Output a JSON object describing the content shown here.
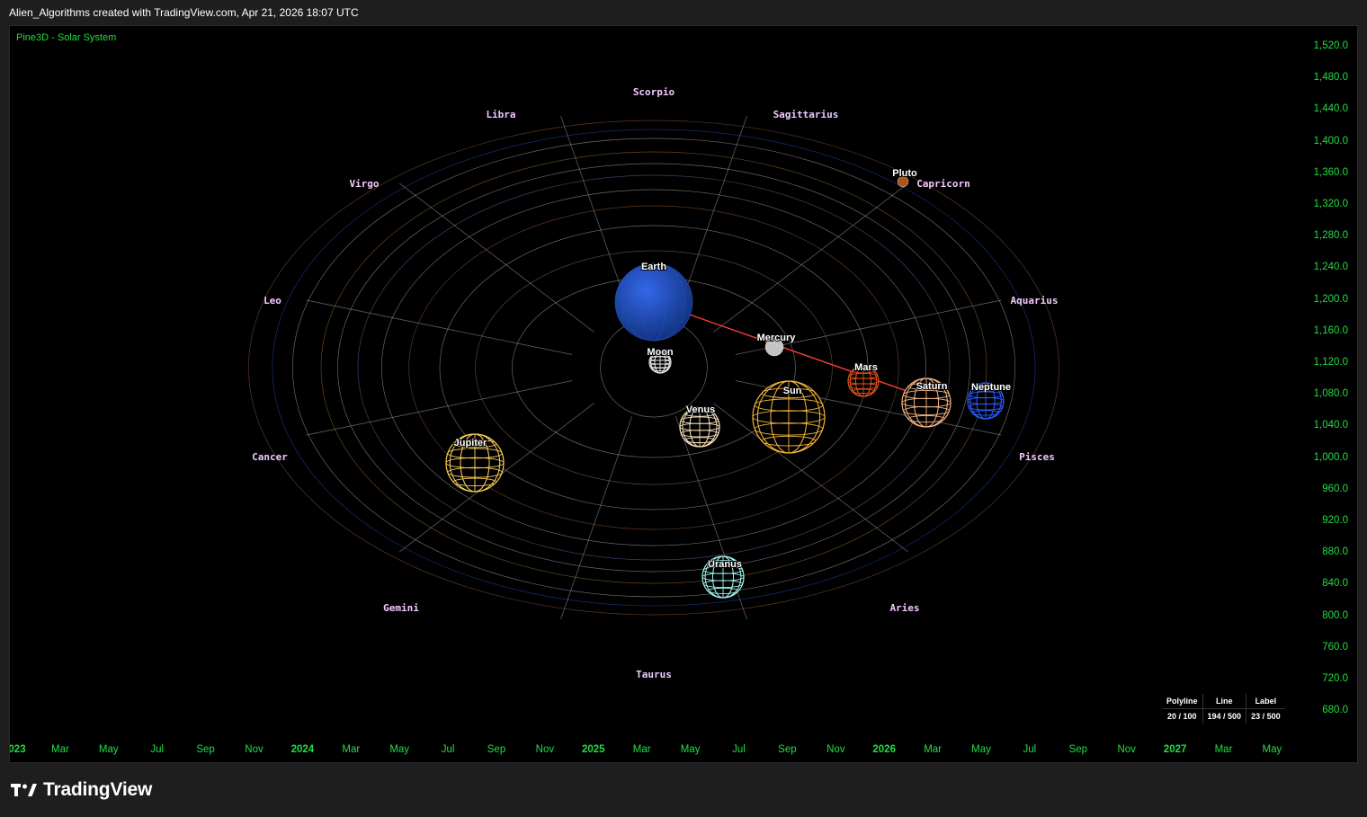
{
  "header": {
    "caption": "Alien_Algorithms created with TradingView.com, Apr 21, 2026 18:07 UTC"
  },
  "indicator": {
    "title": "Pine3D - Solar System"
  },
  "price_axis": {
    "ticks": [
      "1,520.0",
      "1,480.0",
      "1,440.0",
      "1,400.0",
      "1,360.0",
      "1,320.0",
      "1,280.0",
      "1,240.0",
      "1,200.0",
      "1,160.0",
      "1,120.0",
      "1,080.0",
      "1,040.0",
      "1,000.0",
      "960.0",
      "920.0",
      "880.0",
      "840.0",
      "800.0",
      "760.0",
      "720.0",
      "680.0"
    ]
  },
  "time_axis": {
    "ticks": [
      {
        "label": "023",
        "year": true
      },
      {
        "label": "Mar"
      },
      {
        "label": "May"
      },
      {
        "label": "Jul"
      },
      {
        "label": "Sep"
      },
      {
        "label": "Nov"
      },
      {
        "label": "2024",
        "year": true
      },
      {
        "label": "Mar"
      },
      {
        "label": "May"
      },
      {
        "label": "Jul"
      },
      {
        "label": "Sep"
      },
      {
        "label": "Nov"
      },
      {
        "label": "2025",
        "year": true
      },
      {
        "label": "Mar"
      },
      {
        "label": "May"
      },
      {
        "label": "Jul"
      },
      {
        "label": "Sep"
      },
      {
        "label": "Nov"
      },
      {
        "label": "2026",
        "year": true
      },
      {
        "label": "Mar"
      },
      {
        "label": "May"
      },
      {
        "label": "Jul"
      },
      {
        "label": "Sep"
      },
      {
        "label": "Nov"
      },
      {
        "label": "2027",
        "year": true
      },
      {
        "label": "Mar"
      },
      {
        "label": "May"
      }
    ]
  },
  "zodiac": [
    "Scorpio",
    "Libra",
    "Sagittarius",
    "Virgo",
    "Capricorn",
    "Leo",
    "Aquarius",
    "Cancer",
    "Pisces",
    "Gemini",
    "Aries",
    "Taurus"
  ],
  "planets": [
    {
      "name": "Earth",
      "color": "#1f4fc4",
      "type": "solid"
    },
    {
      "name": "Moon",
      "color": "#e8e8e8",
      "type": "wire"
    },
    {
      "name": "Mercury",
      "color": "#cfcfcf",
      "type": "solid"
    },
    {
      "name": "Mars",
      "color": "#e0501c",
      "type": "wire"
    },
    {
      "name": "Pluto",
      "color": "#b85a1c",
      "type": "solid"
    },
    {
      "name": "Saturn",
      "color": "#f0b080",
      "type": "wire"
    },
    {
      "name": "Neptune",
      "color": "#2a5cff",
      "type": "wire"
    },
    {
      "name": "Venus",
      "color": "#f5dcb8",
      "type": "wire"
    },
    {
      "name": "Sun",
      "color": "#f2b43a",
      "type": "wire"
    },
    {
      "name": "Jupiter",
      "color": "#f5cd5a",
      "type": "wire"
    },
    {
      "name": "Uranus",
      "color": "#9ff0ea",
      "type": "wire"
    }
  ],
  "colors": {
    "axis_text": "#22dd44",
    "zodiac_text": "#f1c9ff",
    "laser": "#ff3b3b",
    "grid": "#8a8a8a"
  },
  "stats": {
    "headers": [
      "Polyline",
      "Line",
      "Label"
    ],
    "values": [
      "20 / 100",
      "194 / 500",
      "23 / 500"
    ]
  },
  "footer": {
    "brand": "TradingView"
  }
}
